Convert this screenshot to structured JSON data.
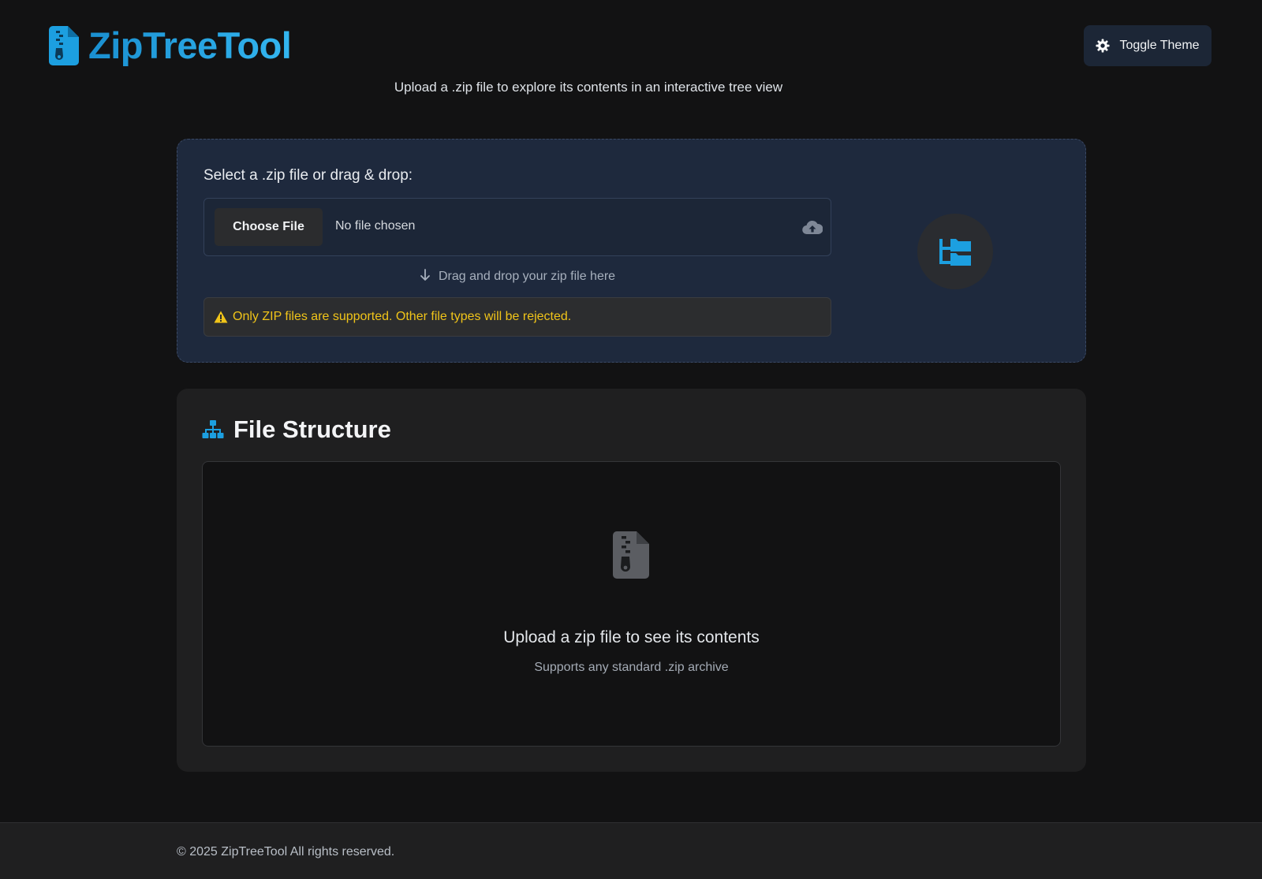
{
  "header": {
    "title": "ZipTreeTool",
    "subtitle": "Upload a .zip file to explore its contents in an interactive tree view",
    "toggle_label": "Toggle Theme",
    "icons": {
      "brand": "file-zipper-icon",
      "toggle": "gear-icon"
    }
  },
  "upload": {
    "heading": "Select a .zip file or drag & drop:",
    "choose_button": "Choose File",
    "file_status": "No file chosen",
    "drag_hint": "Drag and drop your zip file here",
    "warning": "Only ZIP files are supported. Other file types will be rejected.",
    "icons": {
      "cloud": "cloud-upload-icon",
      "arrow": "arrow-down-icon",
      "warning": "warning-triangle-icon",
      "badge": "folder-tree-icon"
    }
  },
  "structure": {
    "title": "File Structure",
    "empty_title": "Upload a zip file to see its contents",
    "empty_subtitle": "Supports any standard .zip archive",
    "icons": {
      "title": "sitemap-icon",
      "empty": "file-zipper-icon"
    }
  },
  "footer": {
    "text": "© 2025 ZipTreeTool All rights reserved."
  },
  "colors": {
    "background": "#121213",
    "accent": "#1ea2e0",
    "upload_card": "#1e293d",
    "warning_text": "#f0c419",
    "card": "#1f1f20"
  }
}
